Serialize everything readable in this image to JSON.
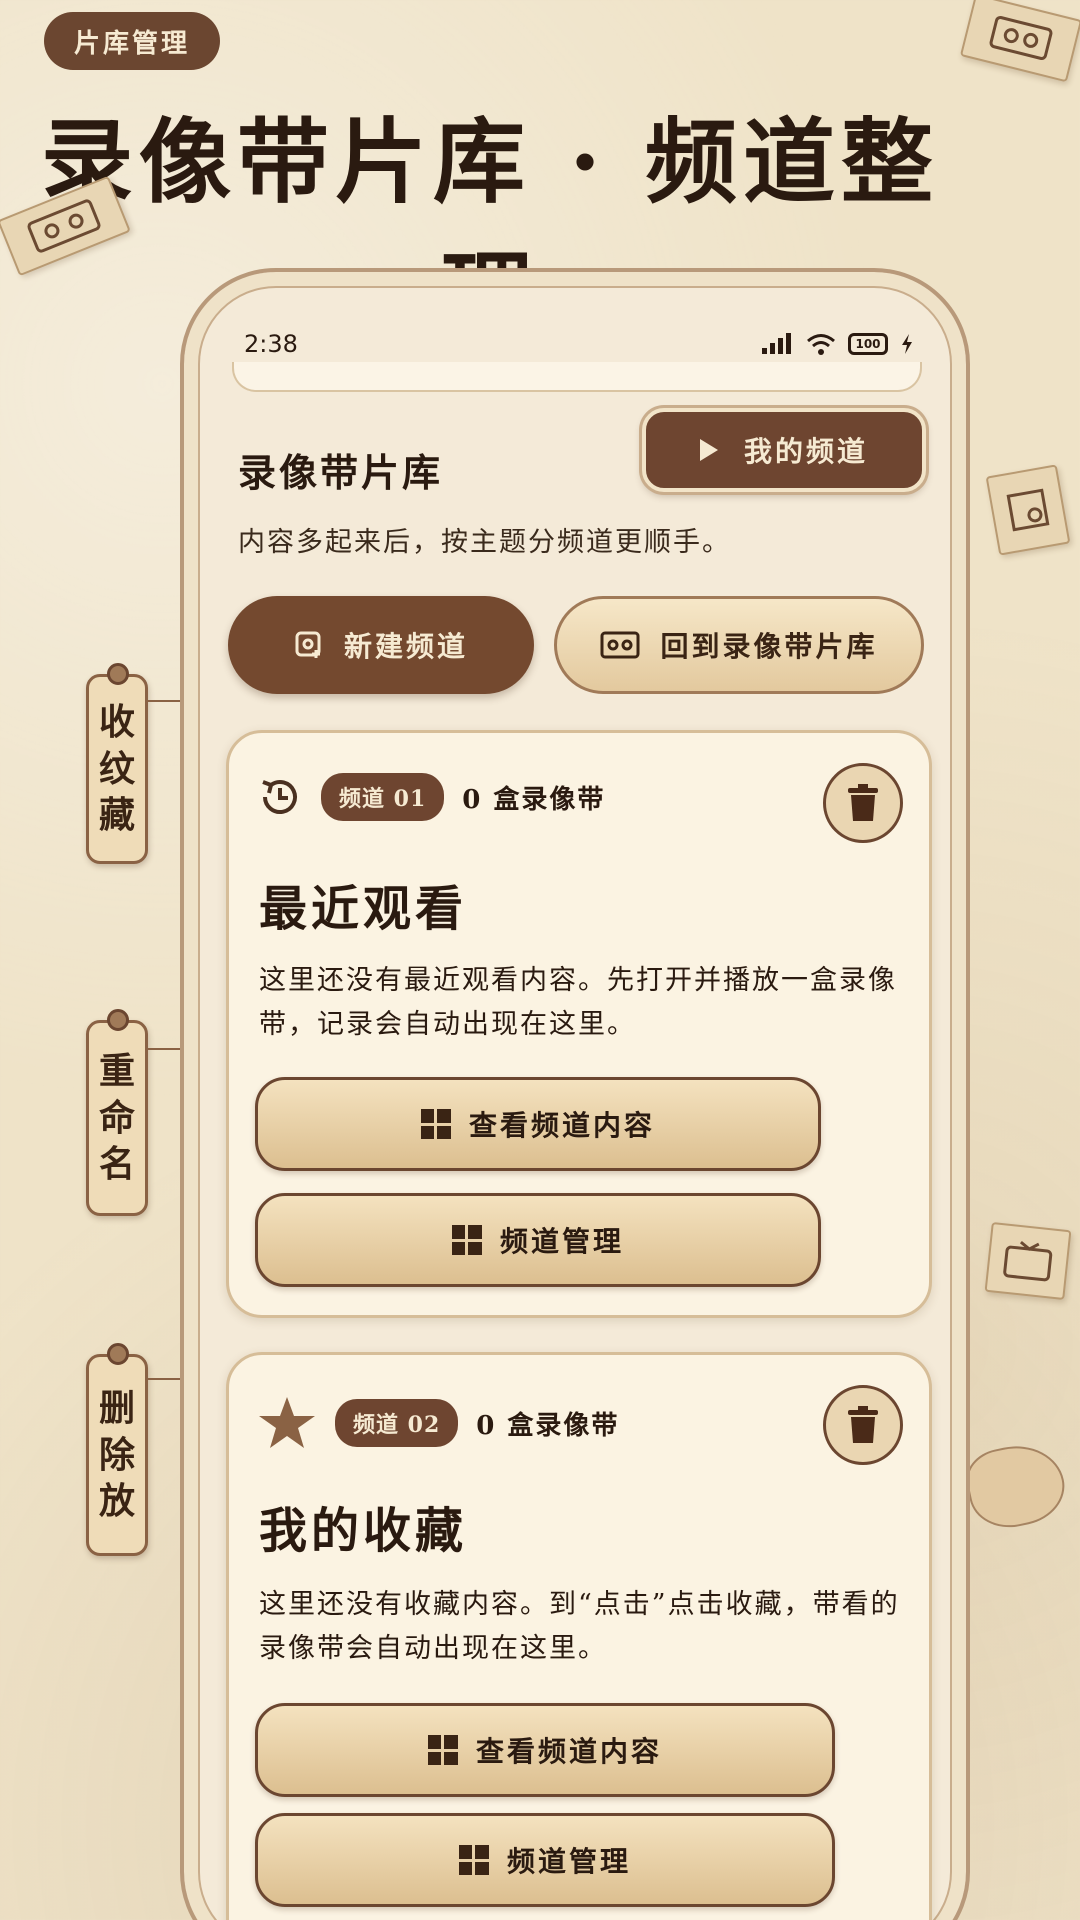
{
  "top_tag": "片库管理",
  "hero_title": "录像带片库 · 频道整理",
  "side_tags": [
    {
      "label": "收\n纹\n藏"
    },
    {
      "label": "重\n命\n名"
    },
    {
      "label": "删\n除\n放"
    }
  ],
  "status_bar": {
    "time": "2:38",
    "battery": "100"
  },
  "library": {
    "title": "录像带片库",
    "description": "内容多起来后，按主题分频道更顺手。",
    "my_channel_label": "我的频道",
    "new_channel_label": "新建频道",
    "back_to_library_label": "回到录像带片库"
  },
  "channels": [
    {
      "badge": "频道 01",
      "count": "0 盒录像带",
      "title": "最近观看",
      "description": "这里还没有最近观看内容。先打开并播放一盒录像带，记录会自动出现在这里。",
      "view_label": "查看频道内容",
      "manage_label": "频道管理",
      "icon": "history-icon"
    },
    {
      "badge": "频道 02",
      "count": "0 盒录像带",
      "title": "我的收藏",
      "description": "这里还没有收藏内容。到“点击”点击收藏，带看的录像带会自动出现在这里。",
      "view_label": "查看频道内容",
      "manage_label": "频道管理",
      "icon": "star-icon"
    }
  ],
  "colors": {
    "accent_dark": "#6e4530",
    "paper": "#efe3c8",
    "card": "#fbf3e2"
  }
}
